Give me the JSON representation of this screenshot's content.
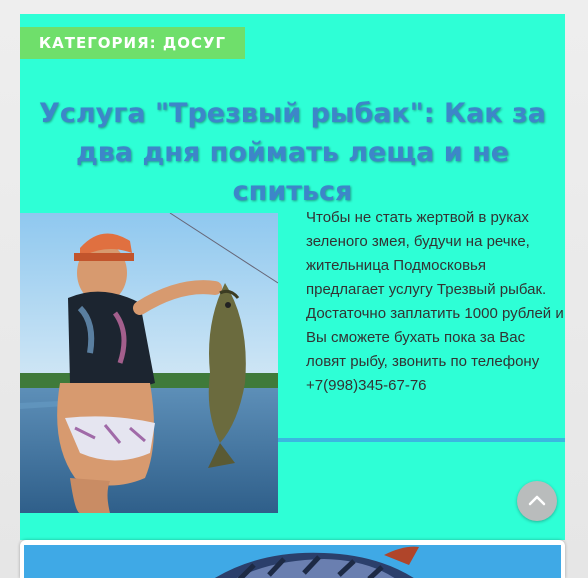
{
  "post": {
    "category_label": "КАТЕГОРИЯ: ДОСУГ",
    "title": "Услуга \"Трезвый рыбак\": Как за два дня поймать леща и не спиться",
    "excerpt": "Чтобы не стать жертвой в руках зеленого змея, будучи на речке, жительница Подмосковья предлагает услугу Трезвый рыбак. Достаточно заплатить 1000 рублей и Вы сможете бухать пока за Вас ловят рыбу, звонить по телефону +7(998)345-67-76",
    "image_icon": "woman-holding-fish-photo"
  },
  "scroll_top": {
    "icon": "chevron-up-icon"
  },
  "next_post": {
    "image_icon": "fish-photo"
  },
  "colors": {
    "card_bg": "#2effd6",
    "category_bg": "#6fdf6b",
    "title": "#3d86c9",
    "divider": "#3ab8e0",
    "scroll_button": "#b9bcbc"
  }
}
